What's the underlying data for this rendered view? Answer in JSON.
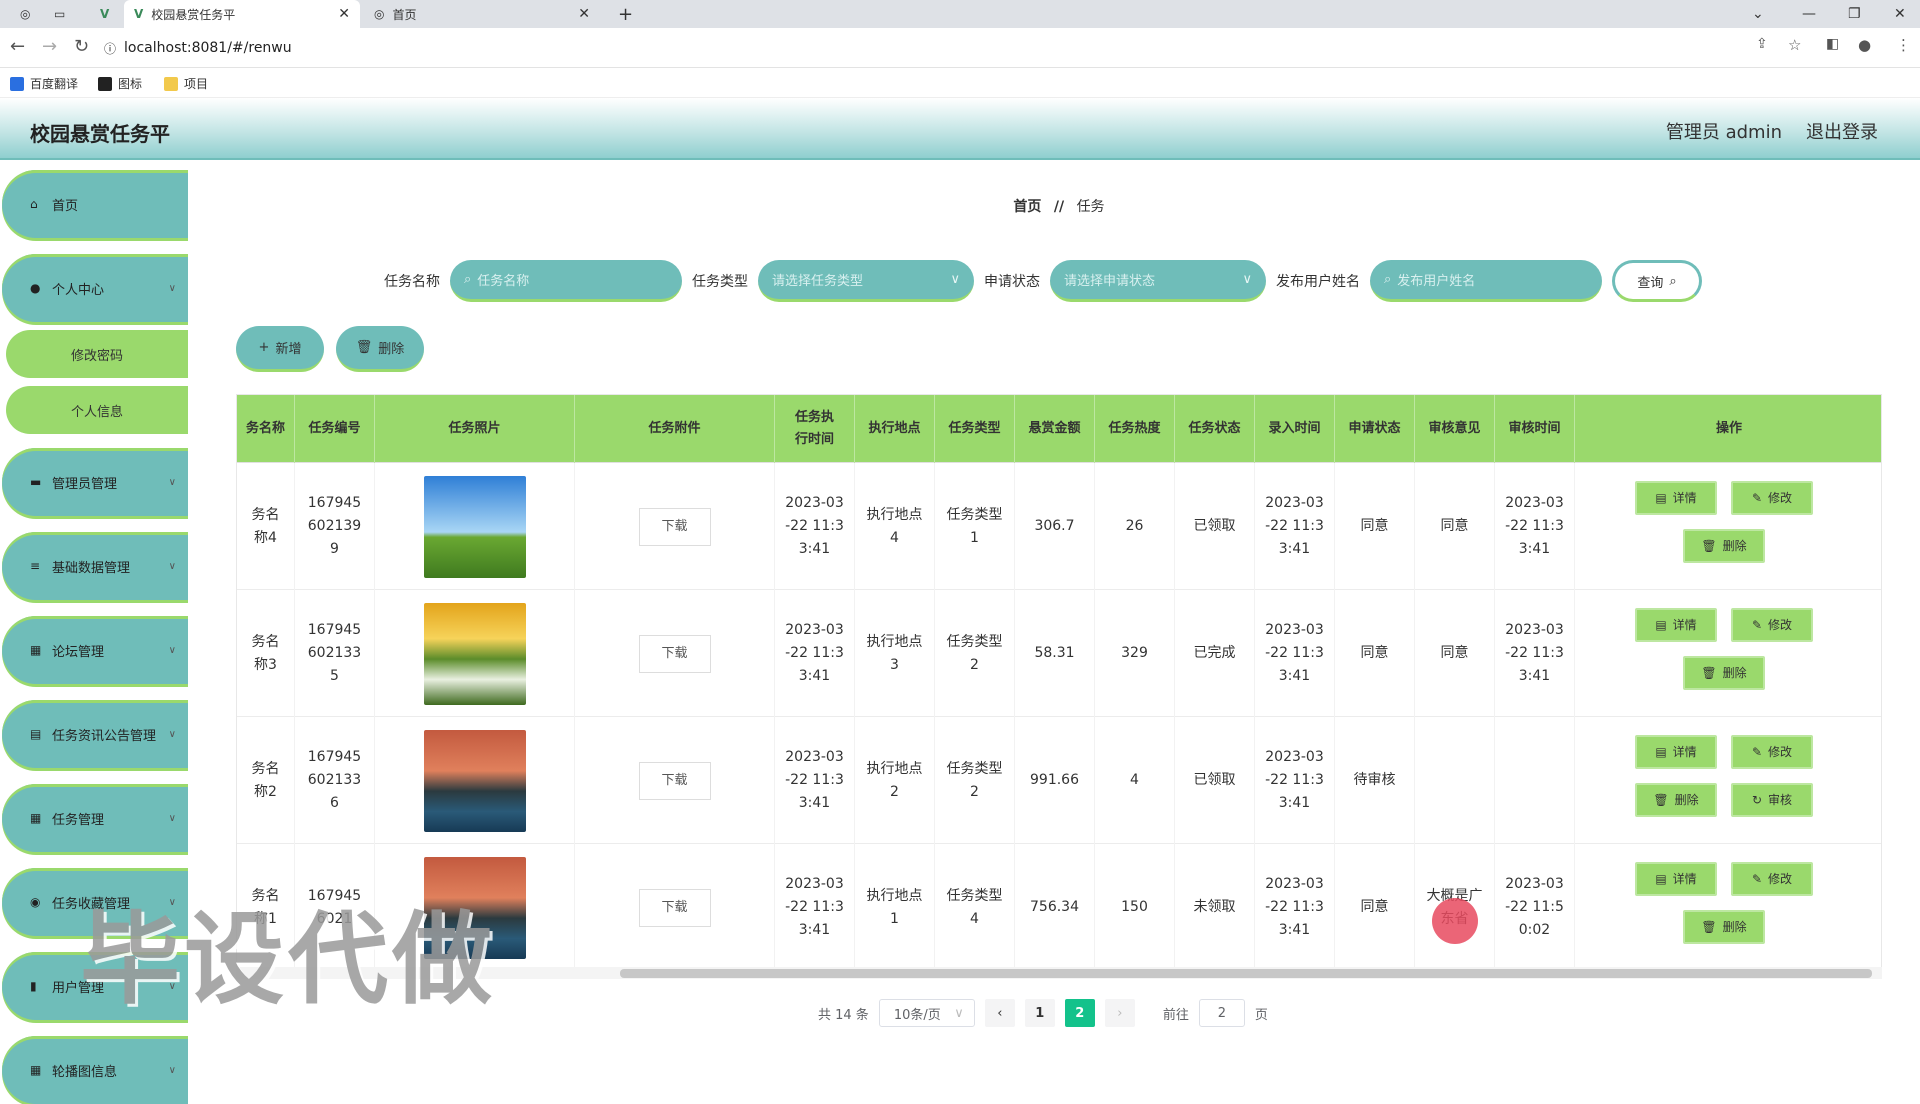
{
  "browser": {
    "tabs": [
      {
        "label": "校园悬赏任务平",
        "active": true
      },
      {
        "label": "首页",
        "active": false
      }
    ],
    "url": "localhost:8081/#/renwu",
    "bookmarks": [
      "百度翻译",
      "图标",
      "项目"
    ]
  },
  "header": {
    "title": "校园悬赏任务平",
    "user": "管理员 admin",
    "logout": "退出登录"
  },
  "sidebar": {
    "items": [
      {
        "label": "首页",
        "icon": "home-icon"
      },
      {
        "label": "个人中心",
        "icon": "user-icon"
      },
      {
        "label": "修改密码",
        "sub": true
      },
      {
        "label": "个人信息",
        "sub": true
      },
      {
        "label": "管理员管理",
        "icon": "monitor-icon"
      },
      {
        "label": "基础数据管理",
        "icon": "list-icon"
      },
      {
        "label": "论坛管理",
        "icon": "grid-icon"
      },
      {
        "label": "任务资讯公告管理",
        "icon": "doc-icon"
      },
      {
        "label": "任务管理",
        "icon": "grid-icon"
      },
      {
        "label": "任务收藏管理",
        "icon": "location-icon"
      },
      {
        "label": "用户管理",
        "icon": "bar-chart-icon"
      },
      {
        "label": "轮播图信息",
        "icon": "grid-icon"
      }
    ]
  },
  "breadcrumb": {
    "home": "首页",
    "sep": "//",
    "current": "任务"
  },
  "search": {
    "name_label": "任务名称",
    "name_placeholder": "任务名称",
    "type_label": "任务类型",
    "type_placeholder": "请选择任务类型",
    "status_label": "申请状态",
    "status_placeholder": "请选择申请状态",
    "user_label": "发布用户姓名",
    "user_placeholder": "发布用户姓名",
    "query": "查询"
  },
  "actions": {
    "add": "新增",
    "delete": "删除"
  },
  "table": {
    "columns": [
      "务名称",
      "任务编号",
      "任务照片",
      "任务附件",
      "任务执行时间",
      "执行地点",
      "任务类型",
      "悬赏金额",
      "任务热度",
      "任务状态",
      "录入时间",
      "申请状态",
      "审核意见",
      "审核时间",
      "操作"
    ],
    "download": "下载",
    "ops": {
      "detail": "详情",
      "edit": "修改",
      "delete": "删除",
      "review": "审核"
    },
    "rows": [
      {
        "name": "务名称4",
        "code": "1679456021399",
        "photo": "sky",
        "time": "2023-03-22 11:33:41",
        "place": "执行地点4",
        "type": "任务类型1",
        "amount": "306.7",
        "heat": "26",
        "status": "已领取",
        "created": "2023-03-22 11:33:41",
        "apply": "同意",
        "opinion": "同意",
        "reviewed": "2023-03-22 11:33:41",
        "review_btn": false
      },
      {
        "name": "务名称3",
        "code": "1679456021335",
        "photo": "flowers",
        "time": "2023-03-22 11:33:41",
        "place": "执行地点3",
        "type": "任务类型2",
        "amount": "58.31",
        "heat": "329",
        "status": "已完成",
        "created": "2023-03-22 11:33:41",
        "apply": "同意",
        "opinion": "同意",
        "reviewed": "2023-03-22 11:33:41",
        "review_btn": false
      },
      {
        "name": "务名称2",
        "code": "1679456021336",
        "photo": "lake",
        "time": "2023-03-22 11:33:41",
        "place": "执行地点2",
        "type": "任务类型2",
        "amount": "991.66",
        "heat": "4",
        "status": "已领取",
        "created": "2023-03-22 11:33:41",
        "apply": "待审核",
        "opinion": "",
        "reviewed": "",
        "review_btn": true
      },
      {
        "name": "务名称1",
        "code": "1679456021",
        "photo": "lake",
        "time": "2023-03-22 11:33:41",
        "place": "执行地点1",
        "type": "任务类型4",
        "amount": "756.34",
        "heat": "150",
        "status": "未领取",
        "created": "2023-03-22 11:33:41",
        "apply": "同意",
        "opinion": "大概是广东省",
        "reviewed": "2023-03-22 11:50:02",
        "review_btn": false
      }
    ]
  },
  "pagination": {
    "total": "共 14 条",
    "size": "10条/页",
    "pages": [
      "1",
      "2"
    ],
    "current": "2",
    "goto": "前往",
    "goto_value": "2",
    "page_unit": "页"
  },
  "watermark": "毕设代做",
  "colors": {
    "teal": "#6fbdb9",
    "green": "#9ad96c",
    "active_page": "#13c28b"
  }
}
